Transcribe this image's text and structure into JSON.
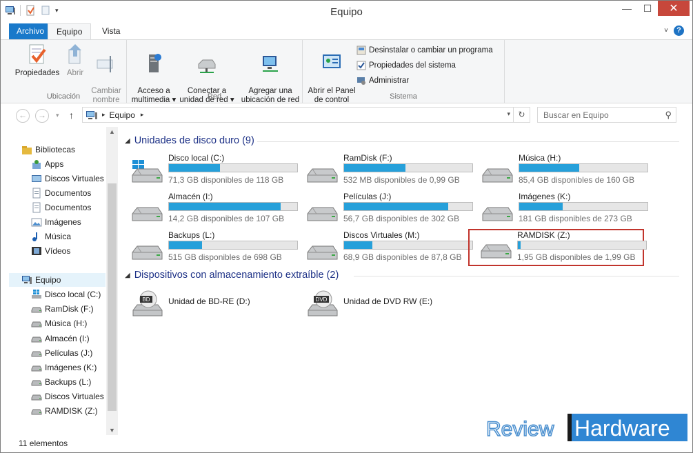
{
  "window": {
    "title": "Equipo"
  },
  "tabs": {
    "file": "Archivo",
    "active": "Equipo",
    "view": "Vista"
  },
  "ribbon": {
    "groups": [
      {
        "label": "Ubicación",
        "buttons": [
          {
            "label": "Propiedades",
            "enabled": true
          },
          {
            "label": "Abrir",
            "enabled": false
          },
          {
            "label": "Cambiar\nnombre",
            "enabled": false
          }
        ]
      },
      {
        "label": "Red",
        "buttons": [
          {
            "label": "Acceso a\nmultimedia ▾"
          },
          {
            "label": "Conectar a\nunidad de red ▾"
          },
          {
            "label": "Agregar una\nubicación de red"
          }
        ]
      },
      {
        "label": "Sistema",
        "buttons": [
          {
            "label": "Abrir el Panel\nde control"
          }
        ]
      }
    ],
    "system_small": [
      "Desinstalar o cambiar un programa",
      "Propiedades del sistema",
      "Administrar"
    ]
  },
  "address": {
    "crumb": "Equipo",
    "search_placeholder": "Buscar en Equipo"
  },
  "nav": {
    "libraries": {
      "label": "Bibliotecas",
      "items": [
        "Apps",
        "Discos Virtuales",
        "Documentos",
        "Documentos",
        "Imágenes",
        "Música",
        "Vídeos"
      ]
    },
    "computer": {
      "label": "Equipo",
      "items": [
        "Disco local (C:)",
        "RamDisk (F:)",
        "Música (H:)",
        "Almacén (I:)",
        "Películas (J:)",
        "Imágenes (K:)",
        "Backups (L:)",
        "Discos Virtuales (",
        "RAMDISK (Z:)"
      ]
    }
  },
  "sections": {
    "hdd": "Unidades de disco duro (9)",
    "removable": "Dispositivos con almacenamiento extraíble (2)"
  },
  "drives": [
    {
      "name": "Disco local (C:)",
      "info": "71,3 GB disponibles de 118 GB",
      "used": 0.4,
      "icon": "windows-drive-icon"
    },
    {
      "name": "RamDisk (F:)",
      "info": "532 MB disponibles de 0,99 GB",
      "used": 0.48,
      "icon": "hard-drive-icon"
    },
    {
      "name": "Música (H:)",
      "info": "85,4 GB disponibles de 160 GB",
      "used": 0.47,
      "icon": "hard-drive-icon"
    },
    {
      "name": "Almacén (I:)",
      "info": "14,2 GB disponibles de 107 GB",
      "used": 0.87,
      "icon": "hard-drive-icon"
    },
    {
      "name": "Películas (J:)",
      "info": "56,7 GB disponibles de 302 GB",
      "used": 0.81,
      "icon": "hard-drive-icon"
    },
    {
      "name": "Imágenes (K:)",
      "info": "181 GB disponibles de 273 GB",
      "used": 0.34,
      "icon": "hard-drive-icon"
    },
    {
      "name": "Backups (L:)",
      "info": "515 GB disponibles de 698 GB",
      "used": 0.26,
      "icon": "hard-drive-icon"
    },
    {
      "name": "Discos Virtuales (M:)",
      "info": "68,9 GB disponibles de 87,8 GB",
      "used": 0.22,
      "icon": "hard-drive-icon"
    },
    {
      "name": "RAMDISK (Z:)",
      "info": "1,95 GB disponibles de 1,99 GB",
      "used": 0.02,
      "icon": "hard-drive-icon",
      "highlighted": true
    }
  ],
  "removable": [
    {
      "name": "Unidad de BD-RE (D:)",
      "badge": "BD"
    },
    {
      "name": "Unidad de DVD RW (E:)",
      "badge": "DVD"
    }
  ],
  "status": {
    "count": "11 elementos"
  },
  "watermark": {
    "word1": "Review",
    "word2": "Hardware"
  },
  "colors": {
    "accent": "#1979ca",
    "bar_fill": "#26a0da",
    "highlight": "#c1342c",
    "section_title": "#1e3287"
  }
}
